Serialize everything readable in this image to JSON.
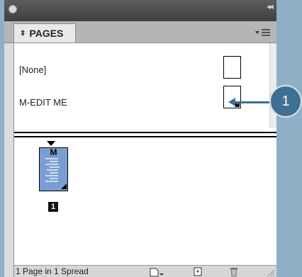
{
  "panel": {
    "tab_label": "PAGES",
    "tab_arrows": "◆"
  },
  "masters": [
    {
      "label": "[None]"
    },
    {
      "label": "M-EDIT ME"
    }
  ],
  "pages": [
    {
      "prefix": "M",
      "number": "1"
    }
  ],
  "footer": {
    "status": "1 Page in 1 Spread"
  },
  "callout": {
    "number": "1"
  },
  "icons": {
    "tab": "expand-collapse-icon",
    "menu": "panel-menu-icon",
    "new_page": "new-page-icon",
    "edit_size": "edit-page-size-icon",
    "delete": "trash-icon"
  },
  "colors": {
    "background": "#8db0c7",
    "callout": "#3f6f92",
    "page_thumb": "#7b9ed1"
  }
}
